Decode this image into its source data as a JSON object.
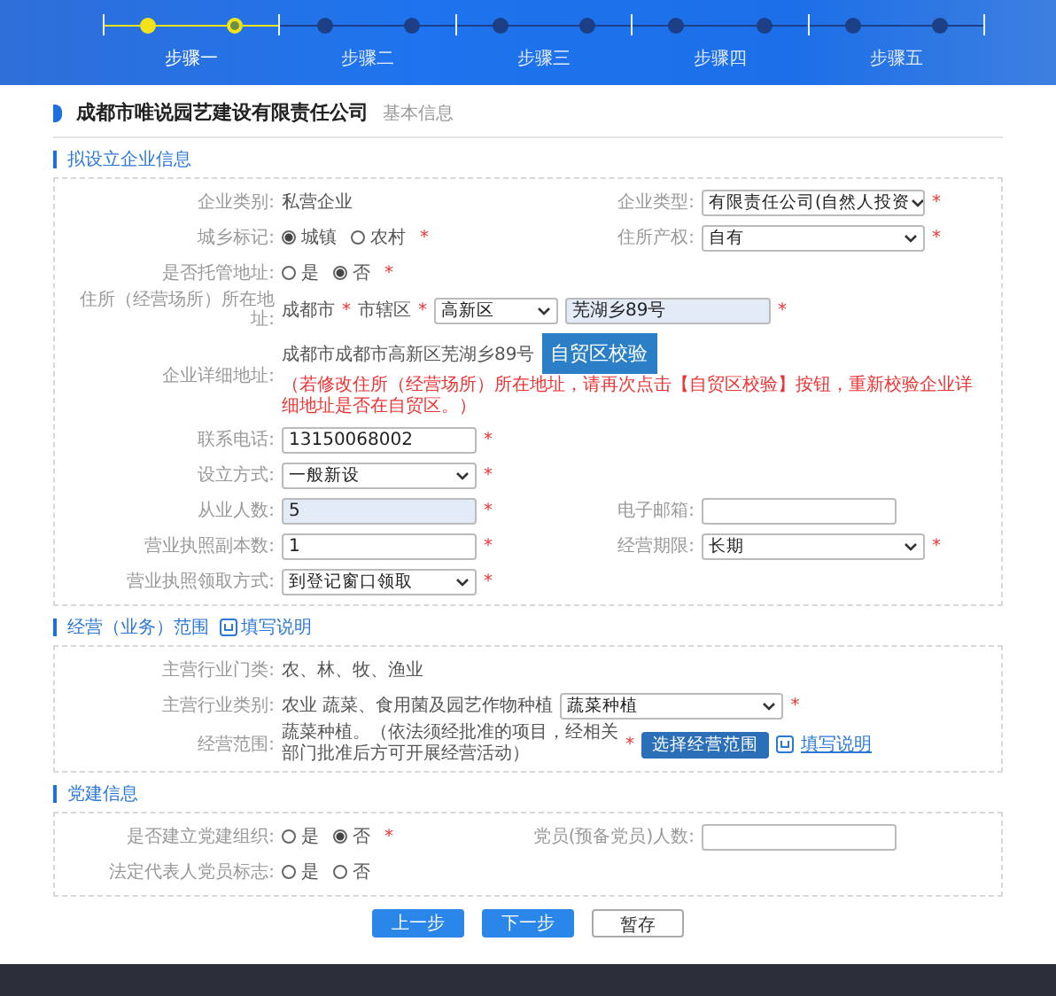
{
  "steps": [
    {
      "label": "步骤一",
      "selected": true
    },
    {
      "label": "步骤二",
      "selected": false
    },
    {
      "label": "步骤三",
      "selected": false
    },
    {
      "label": "步骤四",
      "selected": false
    },
    {
      "label": "步骤五",
      "selected": false
    }
  ],
  "company": {
    "name": "成都市唯说园艺建设有限责任公司",
    "subtitle": "基本信息"
  },
  "sections": [
    {
      "title": "拟设立企业信息",
      "rows": [
        {
          "fields": [
            {
              "kind": "text",
              "label": "企业类别:",
              "value": "私营企业"
            },
            {
              "kind": "select",
              "label": "企业类型:",
              "value": "有限责任公司(自然人投资",
              "required_mark": "*"
            }
          ]
        },
        {
          "fields": [
            {
              "kind": "radio",
              "label": "城乡标记:",
              "options": [
                {
                  "label": "城镇",
                  "selected": true
                },
                {
                  "label": "农村",
                  "selected": false
                }
              ],
              "required_mark": "*"
            },
            {
              "kind": "select",
              "label": "住所产权:",
              "value": "自有",
              "required_mark": "*"
            }
          ]
        },
        {
          "fields": [
            {
              "kind": "radio",
              "label": "是否托管地址:",
              "options": [
                {
                  "label": "是",
                  "selected": false
                },
                {
                  "label": "否",
                  "selected": true
                }
              ],
              "required_mark": "*"
            }
          ]
        },
        {
          "fields": [
            {
              "kind": "address",
              "label": "住所（经营场所）所在地址:",
              "city": "成都市",
              "city_mark": "*",
              "district": "市辖区",
              "district_mark": "*",
              "area": "高新区",
              "street": "芜湖乡89号",
              "required_mark": "*"
            }
          ]
        },
        {
          "fields": [
            {
              "kind": "detail",
              "label": "企业详细地址:",
              "value": "成都市成都市高新区芜湖乡89号",
              "button": "自贸区校验",
              "note": "（若修改住所（经营场所）所在地址，请再次点击【自贸区校验】按钮，重新校验企业详细地址是否在自贸区。）"
            }
          ]
        },
        {
          "fields": [
            {
              "kind": "input",
              "label": "联系电话:",
              "value": "13150068002",
              "disabled": false,
              "required_mark": "*"
            }
          ]
        },
        {
          "fields": [
            {
              "kind": "select",
              "label": "设立方式:",
              "value": "一般新设",
              "required_mark": "*"
            }
          ]
        },
        {
          "fields": [
            {
              "kind": "input",
              "label": "从业人数:",
              "value": "5",
              "disabled": true,
              "required_mark": "*"
            },
            {
              "kind": "input",
              "label": "电子邮箱:",
              "disabled": false
            }
          ]
        },
        {
          "fields": [
            {
              "kind": "input",
              "label": "营业执照副本数:",
              "value": "1",
              "disabled": false,
              "required_mark": "*"
            },
            {
              "kind": "select",
              "label": "经营期限:",
              "value": "长期",
              "required_mark": "*"
            }
          ]
        },
        {
          "fields": [
            {
              "kind": "select",
              "label": "营业执照领取方式:",
              "value": "到登记窗口领取",
              "required_mark": "*"
            }
          ]
        }
      ]
    },
    {
      "title": "经营（业务）范围",
      "help_link": "填写说明",
      "rows": [
        {
          "fields": [
            {
              "kind": "text",
              "label": "主营行业门类:",
              "value": "农、林、牧、渔业"
            }
          ]
        },
        {
          "fields": [
            {
              "kind": "text_select",
              "label": "主营行业类别:",
              "value": "农业 蔬菜、食用菌及园艺作物种植",
              "select": "蔬菜种植",
              "required_mark": "*"
            }
          ]
        },
        {
          "fields": [
            {
              "kind": "scope",
              "label": "经营范围:",
              "value": "蔬菜种植。（依法须经批准的项目，经相关部门批准后方可开展经营活动）",
              "required_mark": "*",
              "button": "选择经营范围",
              "link": "填写说明"
            }
          ]
        }
      ]
    },
    {
      "title": "党建信息",
      "rows": [
        {
          "fields": [
            {
              "kind": "radio",
              "label": "是否建立党建组织:",
              "options": [
                {
                  "label": "是",
                  "selected": false
                },
                {
                  "label": "否",
                  "selected": true
                }
              ],
              "required_mark": "*"
            },
            {
              "kind": "input",
              "label": "党员(预备党员)人数:",
              "disabled": false
            }
          ]
        },
        {
          "fields": [
            {
              "kind": "radio",
              "label": "法定代表人党员标志:",
              "options": [
                {
                  "label": "是",
                  "selected": false
                },
                {
                  "label": "否",
                  "selected": false
                }
              ]
            }
          ]
        }
      ]
    }
  ],
  "buttons": [
    {
      "label": "上一步",
      "kind": "primary"
    },
    {
      "label": "下一步",
      "kind": "primary"
    },
    {
      "label": "暂存",
      "kind": "plain"
    }
  ]
}
